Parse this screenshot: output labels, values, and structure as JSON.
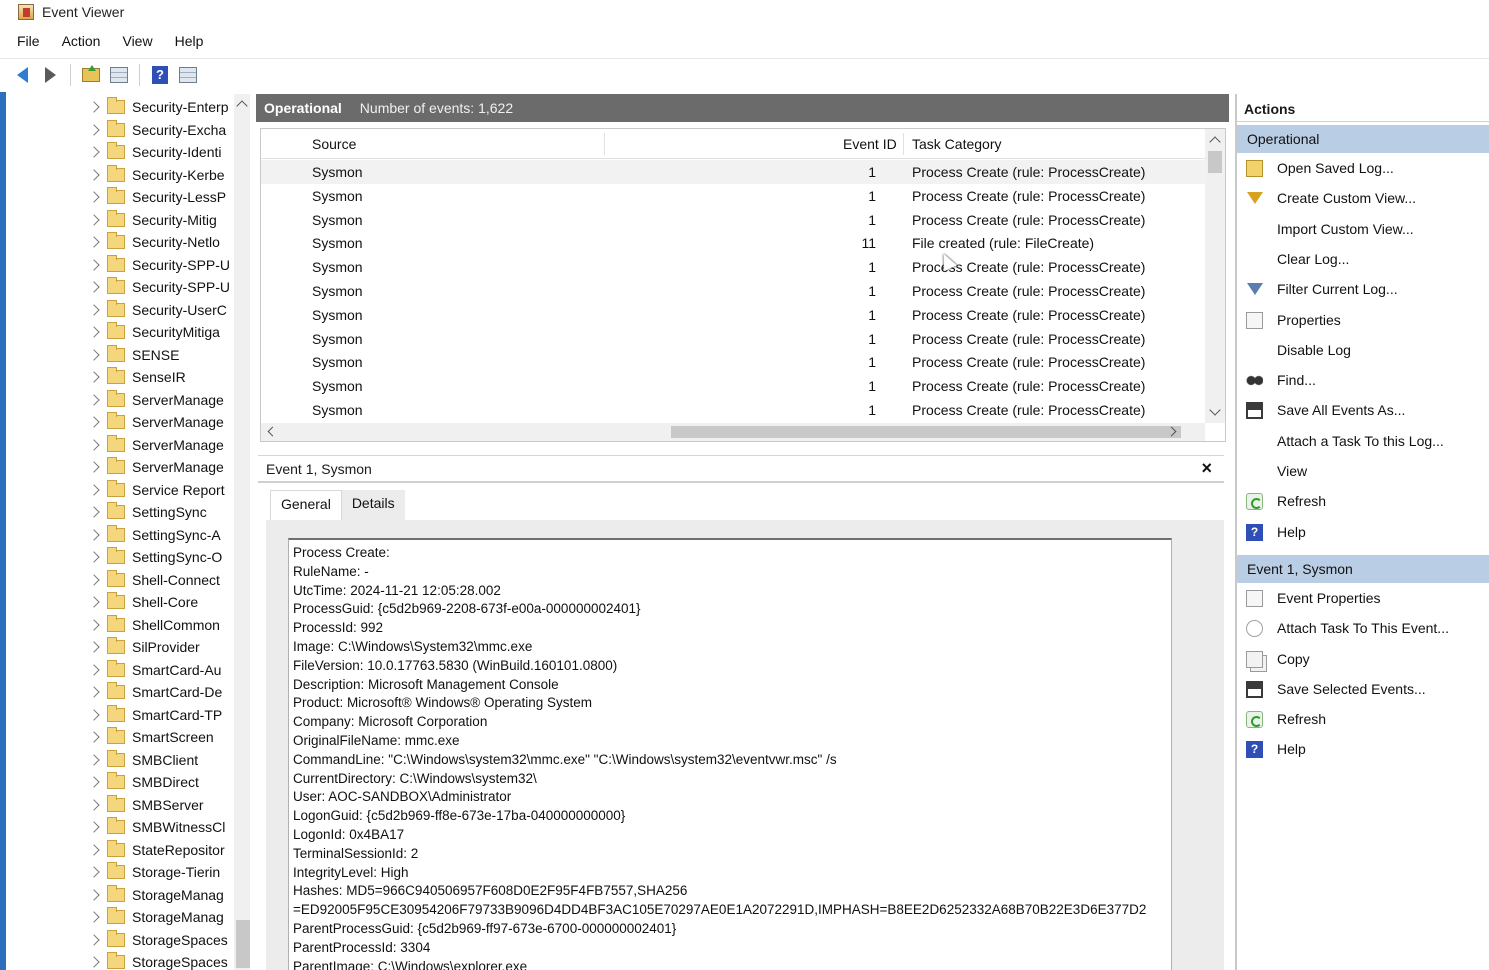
{
  "window": {
    "title": "Event Viewer"
  },
  "menu": [
    "File",
    "Action",
    "View",
    "Help"
  ],
  "toolbar": {
    "icons": [
      "back-arrow-icon",
      "forward-arrow-icon",
      "folder-up-icon",
      "show-hide-tree-icon",
      "help-icon",
      "show-hide-action-pane-icon"
    ]
  },
  "tree": {
    "items": [
      "Security-Enterp",
      "Security-Excha",
      "Security-Identi",
      "Security-Kerbe",
      "Security-LessP",
      "Security-Mitig",
      "Security-Netlo",
      "Security-SPP-U",
      "Security-SPP-U",
      "Security-UserC",
      "SecurityMitiga",
      "SENSE",
      "SenseIR",
      "ServerManage",
      "ServerManage",
      "ServerManage",
      "ServerManage",
      "Service Report",
      "SettingSync",
      "SettingSync-A",
      "SettingSync-O",
      "Shell-Connect",
      "Shell-Core",
      "ShellCommon",
      "SilProvider",
      "SmartCard-Au",
      "SmartCard-De",
      "SmartCard-TP",
      "SmartScreen",
      "SMBClient",
      "SMBDirect",
      "SMBServer",
      "SMBWitnessCl",
      "StateRepositor",
      "Storage-Tierin",
      "StorageManag",
      "StorageManag",
      "StorageSpaces",
      "StorageSpaces"
    ]
  },
  "operational": {
    "title": "Operational",
    "count_text": "Number of events: 1,622",
    "columns": {
      "source": "Source",
      "event_id": "Event ID",
      "task": "Task Category"
    },
    "rows": [
      {
        "source": "Sysmon",
        "id": "1",
        "task": "Process Create (rule: ProcessCreate)"
      },
      {
        "source": "Sysmon",
        "id": "1",
        "task": "Process Create (rule: ProcessCreate)"
      },
      {
        "source": "Sysmon",
        "id": "1",
        "task": "Process Create (rule: ProcessCreate)"
      },
      {
        "source": "Sysmon",
        "id": "11",
        "task": "File created (rule: FileCreate)"
      },
      {
        "source": "Sysmon",
        "id": "1",
        "task": "Process Create (rule: ProcessCreate)"
      },
      {
        "source": "Sysmon",
        "id": "1",
        "task": "Process Create (rule: ProcessCreate)"
      },
      {
        "source": "Sysmon",
        "id": "1",
        "task": "Process Create (rule: ProcessCreate)"
      },
      {
        "source": "Sysmon",
        "id": "1",
        "task": "Process Create (rule: ProcessCreate)"
      },
      {
        "source": "Sysmon",
        "id": "1",
        "task": "Process Create (rule: ProcessCreate)"
      },
      {
        "source": "Sysmon",
        "id": "1",
        "task": "Process Create (rule: ProcessCreate)"
      },
      {
        "source": "Sysmon",
        "id": "1",
        "task": "Process Create (rule: ProcessCreate)"
      }
    ]
  },
  "event": {
    "title": "Event 1, Sysmon",
    "tabs": [
      "General",
      "Details"
    ],
    "lines": [
      "Process Create:",
      "RuleName: -",
      "UtcTime: 2024-11-21 12:05:28.002",
      "ProcessGuid: {c5d2b969-2208-673f-e00a-000000002401}",
      "ProcessId: 992",
      "Image: C:\\Windows\\System32\\mmc.exe",
      "FileVersion: 10.0.17763.5830 (WinBuild.160101.0800)",
      "Description: Microsoft Management Console",
      "Product: Microsoft® Windows® Operating System",
      "Company: Microsoft Corporation",
      "OriginalFileName: mmc.exe",
      "CommandLine: \"C:\\Windows\\system32\\mmc.exe\" \"C:\\Windows\\system32\\eventvwr.msc\" /s",
      "CurrentDirectory: C:\\Windows\\system32\\",
      "User: AOC-SANDBOX\\Administrator",
      "LogonGuid: {c5d2b969-ff8e-673e-17ba-040000000000}",
      "LogonId: 0x4BA17",
      "TerminalSessionId: 2",
      "IntegrityLevel: High",
      "Hashes: MD5=966C940506957F608D0E2F95F4FB7557,SHA256",
      "=ED92005F95CE30954206F79733B9096D4DD4BF3AC105E70297AE0E1A2072291D,IMPHASH=B8EE2D6252332A68B70B22E3D6E377D2",
      "ParentProcessGuid: {c5d2b969-ff97-673e-6700-000000002401}",
      "ParentProcessId: 3304",
      "ParentImage: C:\\Windows\\explorer.exe"
    ]
  },
  "actions": {
    "title": "Actions",
    "sections": [
      {
        "title": "Operational",
        "items": [
          {
            "label": "Open Saved Log...",
            "icon": "open-log-icon"
          },
          {
            "label": "Create Custom View...",
            "icon": "filter-icon"
          },
          {
            "label": "Import Custom View...",
            "icon": ""
          },
          {
            "label": "Clear Log...",
            "icon": ""
          },
          {
            "label": "Filter Current Log...",
            "icon": "filter-icon"
          },
          {
            "label": "Properties",
            "icon": "properties-icon"
          },
          {
            "label": "Disable Log",
            "icon": ""
          },
          {
            "label": "Find...",
            "icon": "binoculars-icon"
          },
          {
            "label": "Save All Events As...",
            "icon": "save-icon"
          },
          {
            "label": "Attach a Task To this Log...",
            "icon": ""
          },
          {
            "label": "View",
            "icon": ""
          },
          {
            "label": "Refresh",
            "icon": "refresh-icon"
          },
          {
            "label": "Help",
            "icon": "help-icon"
          }
        ]
      },
      {
        "title": "Event 1, Sysmon",
        "items": [
          {
            "label": "Event Properties",
            "icon": "properties-icon"
          },
          {
            "label": "Attach Task To This Event...",
            "icon": "task-icon"
          },
          {
            "label": "Copy",
            "icon": "copy-icon"
          },
          {
            "label": "Save Selected Events...",
            "icon": "save-icon"
          },
          {
            "label": "Refresh",
            "icon": "refresh-icon"
          },
          {
            "label": "Help",
            "icon": "help-icon"
          }
        ]
      }
    ]
  }
}
